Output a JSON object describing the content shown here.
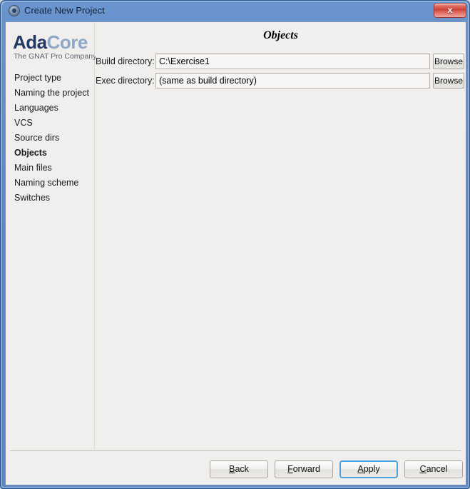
{
  "window": {
    "title": "Create New Project",
    "icon": "gnat-studio-logo-icon",
    "close_label": "x",
    "titlebar_color": "#5b87c5",
    "client_bg": "#f0efee"
  },
  "branding": {
    "logo_part1": "Ada",
    "logo_part2": "Core",
    "tagline": "The GNAT Pro Company",
    "color_part1": "#1f3864",
    "color_part2": "#8fa8c8"
  },
  "sidebar": {
    "items": [
      {
        "label": "Project type",
        "active": false
      },
      {
        "label": "Naming the project",
        "active": false
      },
      {
        "label": "Languages",
        "active": false
      },
      {
        "label": "VCS",
        "active": false
      },
      {
        "label": "Source dirs",
        "active": false
      },
      {
        "label": "Objects",
        "active": true
      },
      {
        "label": "Main files",
        "active": false
      },
      {
        "label": "Naming scheme",
        "active": false
      },
      {
        "label": "Switches",
        "active": false
      }
    ]
  },
  "page": {
    "title": "Objects",
    "fields": [
      {
        "label": "Build directory:",
        "value": "C:\\Exercise1",
        "placeholder": "",
        "browse_label": "Browse"
      },
      {
        "label": "Exec directory:",
        "value": "(same as build directory)",
        "placeholder": "",
        "browse_label": "Browse"
      }
    ]
  },
  "footer": {
    "buttons": [
      {
        "pre": "",
        "mnemonic": "B",
        "post": "ack",
        "default": false
      },
      {
        "pre": "",
        "mnemonic": "F",
        "post": "orward",
        "default": false
      },
      {
        "pre": "",
        "mnemonic": "A",
        "post": "pply",
        "default": true
      },
      {
        "pre": "",
        "mnemonic": "C",
        "post": "ancel",
        "default": false
      }
    ],
    "focus_color": "#4ba3de"
  }
}
